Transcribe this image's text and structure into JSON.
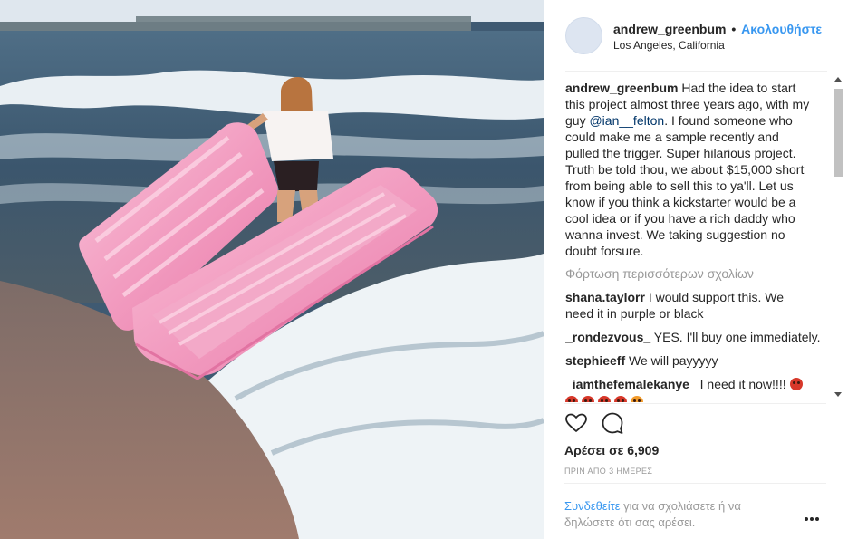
{
  "post": {
    "image_alt": "Woman on the beach at the shore holding a pink inflatable coffin",
    "colors": {
      "coffin": "#f4a3c6",
      "sea": "#3f5a72",
      "foam": "#f3f6f8",
      "sand": "#8a6f66",
      "sky": "#dfe7ee"
    }
  },
  "header": {
    "username": "andrew_greenbum",
    "separator": "•",
    "follow_label": "Ακολουθήστε",
    "location": "Los Angeles, California"
  },
  "caption": {
    "username": "andrew_greenbum",
    "line1_text": "Had the idea to start",
    "line2": "this project almost three years ago, with my",
    "line3_pre": "guy ",
    "mention": "@ian__felton",
    "line3_post": ". I found someone who",
    "lines_rest": [
      "could make me a sample recently and",
      "pulled the trigger. Super hilarious project.",
      "Truth be told thou, we about $15,000 short",
      "from being able to sell this to ya'll. Let us",
      "know if you think a kickstarter would be a",
      "cool idea or if you have a rich daddy who",
      "wanna invest. We taking suggestion no",
      "doubt forsure."
    ]
  },
  "load_more": "Φόρτωση περισσότερων σχολίων",
  "comments": [
    {
      "user": "shana.taylorr",
      "text": "I would support this. We",
      "cont": "need it in purple or black"
    },
    {
      "user": "_rondezvous_",
      "text": "YES. I'll buy one immediately."
    },
    {
      "user": "stephieeff",
      "text": "We will payyyyy"
    },
    {
      "user": "_iamthefemalekanye_",
      "text": "I need it now!!!!"
    }
  ],
  "emoji_row_icons": [
    "angry-face-emoji",
    "angry-face-emoji",
    "angry-face-emoji",
    "angry-face-emoji",
    "heart-eyes-emoji"
  ],
  "likes_text": "Αρέσει σε 6,909",
  "timestamp": "ΠΡΙΝ ΑΠΟ 3 ΗΜΕΡΕΣ",
  "login": {
    "link": "Συνδεθείτε",
    "text": " για να σχολιάσετε ή να δηλώσετε ότι σας αρέσει."
  },
  "icons": {
    "like": "heart-icon",
    "comment": "comment-icon",
    "more": "more-options-icon"
  },
  "accent_color": "#3897f0"
}
